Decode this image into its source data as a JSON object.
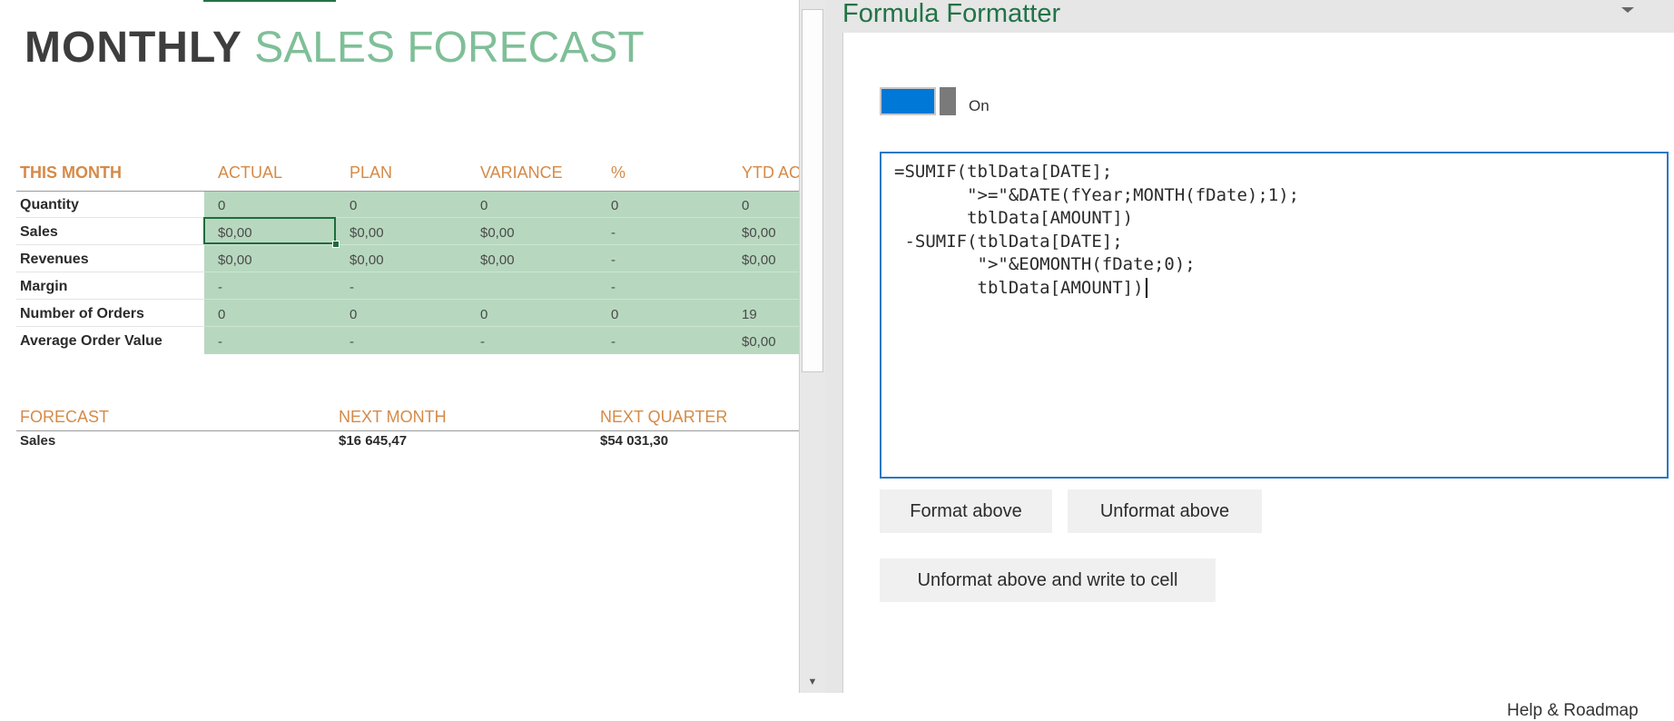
{
  "sheet": {
    "title_part1": "MONTHLY",
    "title_part2": "SALES FORECAST",
    "this_month": {
      "headers": [
        "THIS MONTH",
        "ACTUAL",
        "PLAN",
        "VARIANCE",
        "%",
        "YTD AC"
      ],
      "rows": [
        {
          "label": "Quantity",
          "cells": [
            "0",
            "0",
            "0",
            "0",
            "0"
          ]
        },
        {
          "label": "Sales",
          "cells": [
            "$0,00",
            "$0,00",
            "$0,00",
            "-",
            "$0,00"
          ]
        },
        {
          "label": "Revenues",
          "cells": [
            "$0,00",
            "$0,00",
            "$0,00",
            "-",
            "$0,00"
          ]
        },
        {
          "label": "Margin",
          "cells": [
            "-",
            "-",
            "",
            "-",
            ""
          ]
        },
        {
          "label": "Number of Orders",
          "cells": [
            "0",
            "0",
            "0",
            "0",
            "19"
          ]
        },
        {
          "label": "Average Order Value",
          "cells": [
            "-",
            "-",
            "-",
            "-",
            "$0,00"
          ]
        }
      ]
    },
    "forecast": {
      "headers": [
        "FORECAST",
        "NEXT MONTH",
        "NEXT QUARTER"
      ],
      "row": {
        "label": "Sales",
        "next_month": "$16 645,47",
        "next_quarter": "$54 031,30"
      }
    }
  },
  "pane": {
    "title": "Formula Formatter",
    "menu_icon": "chevron-down-icon",
    "toggle": {
      "label": "On",
      "state": true,
      "accent": "#0078d7"
    },
    "formula": "=SUMIF(tblData[DATE];\n       \">=\"&DATE(fYear;MONTH(fDate);1);\n       tblData[AMOUNT])\n -SUMIF(tblData[DATE];\n        \">\"&EOMONTH(fDate;0);\n        tblData[AMOUNT])",
    "buttons": {
      "format_above": "Format above",
      "unformat_above": "Unformat above",
      "unformat_write": "Unformat above and write to cell"
    },
    "help_link": "Help & Roadmap"
  },
  "colors": {
    "accent_green": "#217346",
    "header_orange": "#d58a47",
    "cell_green": "#b7d8bf",
    "title_green": "#7fbf98"
  }
}
